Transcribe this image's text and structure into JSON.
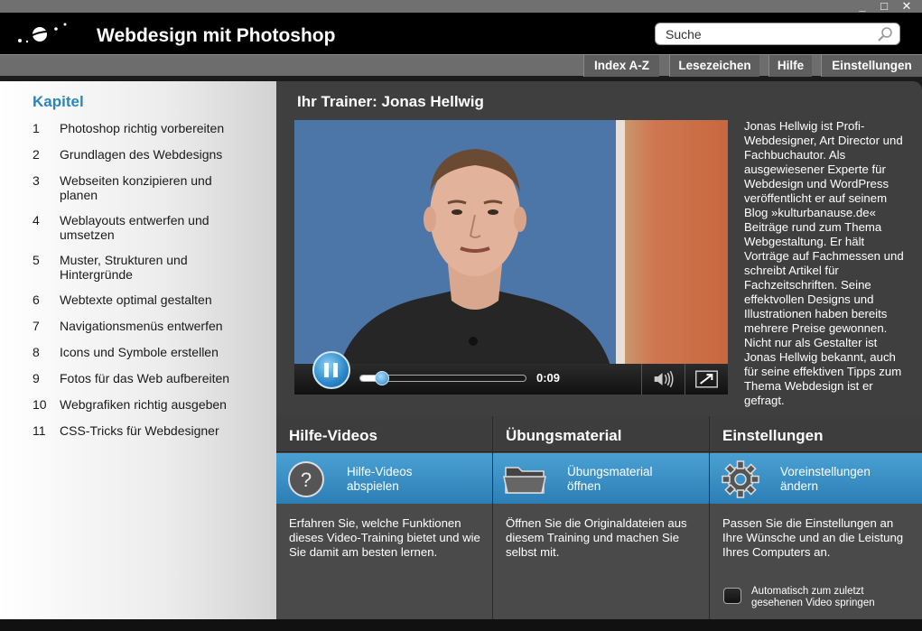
{
  "window": {
    "minimize": "_",
    "maximize": "□",
    "close": "✕"
  },
  "header": {
    "title": "Webdesign mit Photoshop",
    "search_placeholder": "Suche"
  },
  "nav": [
    "Index A-Z",
    "Lesezeichen",
    "Hilfe",
    "Einstellungen"
  ],
  "sidebar": {
    "title": "Kapitel",
    "chapters": [
      {
        "num": "1",
        "label": "Photoshop richtig vorbereiten"
      },
      {
        "num": "2",
        "label": "Grundlagen des Webdesigns"
      },
      {
        "num": "3",
        "label": "Webseiten konzipieren und planen"
      },
      {
        "num": "4",
        "label": "Weblayouts entwerfen und umsetzen"
      },
      {
        "num": "5",
        "label": "Muster, Strukturen und Hintergründe"
      },
      {
        "num": "6",
        "label": "Webtexte optimal gestalten"
      },
      {
        "num": "7",
        "label": "Navigationsmenüs entwerfen"
      },
      {
        "num": "8",
        "label": "Icons und Symbole erstellen"
      },
      {
        "num": "9",
        "label": "Fotos für das Web aufbereiten"
      },
      {
        "num": "10",
        "label": "Webgrafiken richtig ausgeben"
      },
      {
        "num": "11",
        "label": "CSS-Tricks für Webdesigner"
      }
    ]
  },
  "main": {
    "title": "Ihr Trainer: Jonas Hellwig",
    "video": {
      "time": "0:09",
      "progress": 0.13
    },
    "bio": "Jonas Hellwig ist Profi-Webdesigner, Art Director und Fachbuchautor. Als ausgewiesener Experte für Webdesign und WordPress veröffentlicht er auf seinem Blog »kulturbanause.de« Beiträge rund zum Thema Webgestaltung. Er hält Vorträge auf Fachmessen und schreibt Artikel für Fachzeitschriften. Seine effektvollen Designs und Illustrationen haben bereits mehrere Preise gewonnen. Nicht nur als Gestalter ist Jonas Hellwig bekannt, auch für seine effektiven Tipps zum Thema Webdesign ist er gefragt."
  },
  "panels": {
    "help": {
      "title": "Hilfe-Videos",
      "action": "Hilfe-Videos abspielen",
      "description": "Erfahren Sie, welche Funktionen dieses Video-Training bietet und wie Sie damit am besten lernen.",
      "icon": "question-icon"
    },
    "material": {
      "title": "Übungsmaterial",
      "action": "Übungsmaterial öffnen",
      "description": "Öffnen Sie die Originaldateien aus diesem Training und machen Sie selbst mit.",
      "icon": "folder-icon"
    },
    "settings": {
      "title": "Einstellungen",
      "action": "Voreinstellungen ändern",
      "description": "Passen Sie die Einstellungen an Ihre Wünsche und an die Leistung Ihres Computers an.",
      "icon": "gear-icon",
      "checkbox_label": "Automatisch zum zuletzt gesehenen Video springen",
      "checkbox_checked": false
    }
  },
  "colors": {
    "accent": "#2a86b8",
    "action_blue": "#3a90c6"
  }
}
